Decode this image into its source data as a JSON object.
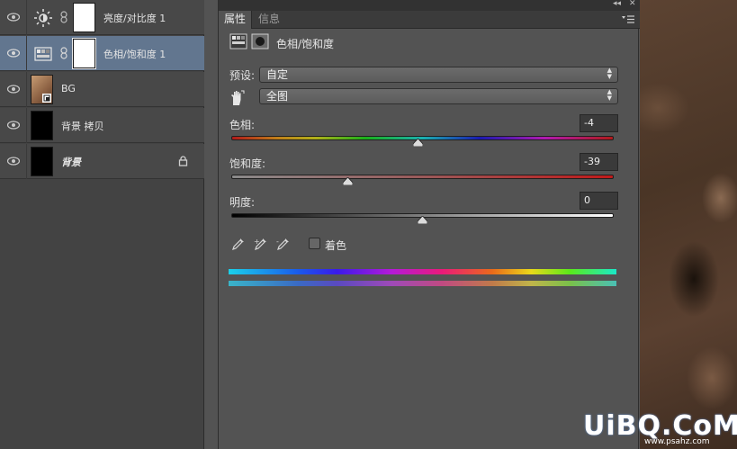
{
  "layers": [
    {
      "name": "亮度/对比度 1",
      "type": "brightness-contrast",
      "selected": false,
      "locked": false
    },
    {
      "name": "色相/饱和度 1",
      "type": "hue-saturation",
      "selected": true,
      "locked": false
    },
    {
      "name": "BG",
      "type": "smart-object",
      "selected": false,
      "locked": false
    },
    {
      "name": "背景 拷贝",
      "type": "pixel",
      "selected": false,
      "locked": false
    },
    {
      "name": "背景",
      "type": "pixel",
      "selected": false,
      "locked": true
    }
  ],
  "properties": {
    "tabs": [
      {
        "label": "属性",
        "active": true
      },
      {
        "label": "信息",
        "active": false
      }
    ],
    "title": "色相/饱和度",
    "preset_label": "预设:",
    "preset_value": "自定",
    "range_value": "全图",
    "hue": {
      "label": "色相:",
      "value": "-4",
      "level": -4,
      "min": -180,
      "max": 180
    },
    "saturation": {
      "label": "饱和度:",
      "value": "-39",
      "level": -39,
      "min": -100,
      "max": 100
    },
    "lightness": {
      "label": "明度:",
      "value": "0",
      "level": 0,
      "min": -100,
      "max": 100
    },
    "colorize_label": "着色",
    "colorize_checked": false
  },
  "watermark": {
    "main": "UiBQ.CoM",
    "sub": "www.psahz.com"
  },
  "icons": {
    "visibility": "eye-icon",
    "brightness": "sun-icon",
    "hue": "hue-saturation-icon",
    "link": "chain-link-icon",
    "lock": "lock-icon",
    "hand": "hand-target-icon",
    "eyedropper": "eyedropper-icon",
    "panel_menu": "panel-menu-icon"
  }
}
